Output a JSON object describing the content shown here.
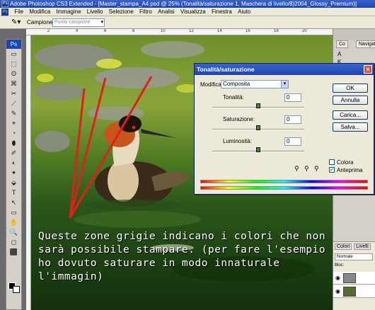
{
  "window": {
    "title": "Adobe Photoshop CS3 Extended - [Master_stampa_A4.psd @ 25% (Tonalità/saturazione 1, Maschera di livello/8)2004_Glossy_Premium)]",
    "app_badge": "Ps"
  },
  "menu": {
    "items": [
      "File",
      "Modifica",
      "Immagine",
      "Livello",
      "Selezione",
      "Filtro",
      "Analisi",
      "Visualizza",
      "Finestra",
      "Aiuto"
    ]
  },
  "options_bar": {
    "sample_label": "Campione:",
    "sample_value": "Punto campione"
  },
  "toolbox": {
    "header": "Ps",
    "tools": [
      "▭",
      "⬚",
      "ʘ",
      "⌘",
      "✂",
      "⟋",
      "✎",
      "⌖",
      "◔",
      "⬮",
      "✐",
      "◐",
      "✦",
      "⬙",
      "T",
      "↖",
      "▭",
      "✋",
      "🔍",
      "◻",
      "⬛"
    ]
  },
  "ruler": {
    "ticks": [
      "2",
      "4",
      "6",
      "8",
      "10",
      "12",
      "14",
      "16",
      "18",
      "20"
    ]
  },
  "image": {
    "caption": "Queste zone grigie indicano i colori che non sarà possibile stampare.  (per fare l'esempio ho dovuto saturare in modo innaturale l'immagin)"
  },
  "right_dock": {
    "nav_tab": "Navigatore",
    "tab_a": "Co",
    "panel_tabs": [
      "Colori",
      "Campi"
    ],
    "layers_tab": "Livelli",
    "blend_mode": "Normale",
    "lock_label": "Bloc:",
    "side_letters": [
      "A",
      "K",
      "¶",
      "A|",
      "K|"
    ]
  },
  "dialog": {
    "title": "Tonalità/saturazione",
    "modify_label": "Modifica:",
    "modify_value": "Composita",
    "hue_label": "Tonalità:",
    "hue_value": "0",
    "saturation_label": "Saturazione:",
    "saturation_value": "0",
    "lightness_label": "Luminosità:",
    "lightness_value": "0",
    "ok_label": "OK",
    "cancel_label": "Annulla",
    "load_label": "Carica...",
    "save_label": "Salva...",
    "colorize_label": "Colora",
    "colorize_checked": false,
    "preview_label": "Anteprima",
    "preview_checked": true,
    "hue_level": 0.5,
    "saturation_level": 0.5,
    "lightness_level": 0.5
  },
  "colors": {
    "title_bar": "#1d46b3",
    "dialog_bg": "#ece9d8",
    "red_lines": "#e0201a"
  }
}
